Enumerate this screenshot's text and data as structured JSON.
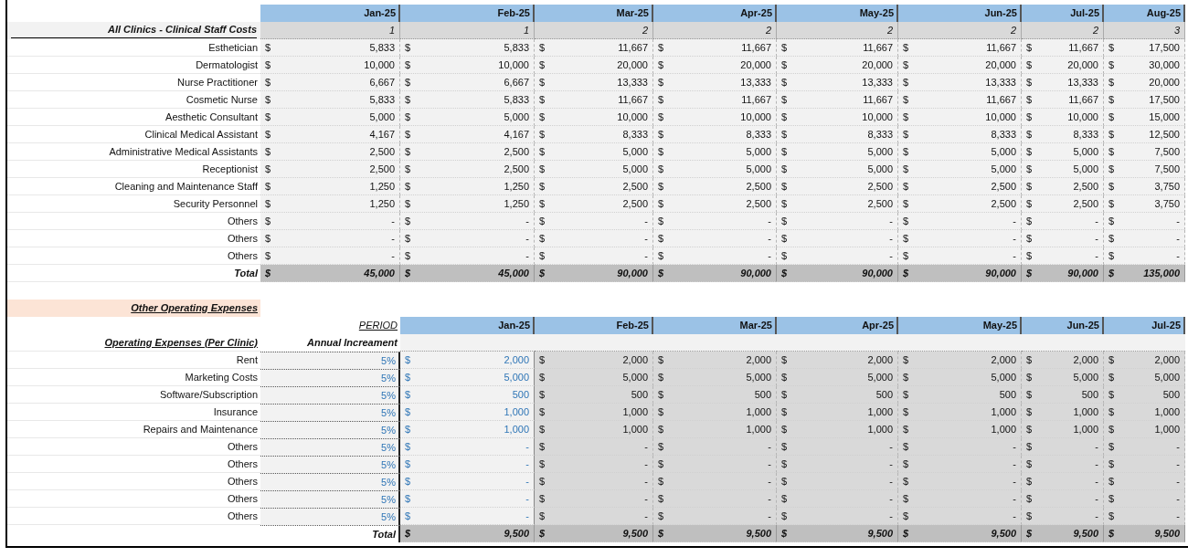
{
  "staff": {
    "title": "All Clinics - Clinical Staff Costs",
    "months": [
      "Jan-25",
      "Feb-25",
      "Mar-25",
      "Apr-25",
      "May-25",
      "Jun-25",
      "Jul-25",
      "Aug-25"
    ],
    "headcount": [
      "1",
      "1",
      "2",
      "2",
      "2",
      "2",
      "2",
      "3"
    ],
    "rows": [
      {
        "label": "Esthetician",
        "cells": [
          [
            "$",
            "5,833"
          ],
          [
            "$",
            "5,833"
          ],
          [
            "$",
            "11,667"
          ],
          [
            "$",
            "11,667"
          ],
          [
            "$",
            "11,667"
          ],
          [
            "$",
            "11,667"
          ],
          [
            "$",
            "11,667"
          ],
          [
            "$",
            "17,500"
          ]
        ]
      },
      {
        "label": "Dermatologist",
        "cells": [
          [
            "$",
            "10,000"
          ],
          [
            "$",
            "10,000"
          ],
          [
            "$",
            "20,000"
          ],
          [
            "$",
            "20,000"
          ],
          [
            "$",
            "20,000"
          ],
          [
            "$",
            "20,000"
          ],
          [
            "$",
            "20,000"
          ],
          [
            "$",
            "30,000"
          ]
        ]
      },
      {
        "label": "Nurse Practitioner",
        "cells": [
          [
            "$",
            "6,667"
          ],
          [
            "$",
            "6,667"
          ],
          [
            "$",
            "13,333"
          ],
          [
            "$",
            "13,333"
          ],
          [
            "$",
            "13,333"
          ],
          [
            "$",
            "13,333"
          ],
          [
            "$",
            "13,333"
          ],
          [
            "$",
            "20,000"
          ]
        ]
      },
      {
        "label": "Cosmetic Nurse",
        "cells": [
          [
            "$",
            "5,833"
          ],
          [
            "$",
            "5,833"
          ],
          [
            "$",
            "11,667"
          ],
          [
            "$",
            "11,667"
          ],
          [
            "$",
            "11,667"
          ],
          [
            "$",
            "11,667"
          ],
          [
            "$",
            "11,667"
          ],
          [
            "$",
            "17,500"
          ]
        ]
      },
      {
        "label": "Aesthetic Consultant",
        "cells": [
          [
            "$",
            "5,000"
          ],
          [
            "$",
            "5,000"
          ],
          [
            "$",
            "10,000"
          ],
          [
            "$",
            "10,000"
          ],
          [
            "$",
            "10,000"
          ],
          [
            "$",
            "10,000"
          ],
          [
            "$",
            "10,000"
          ],
          [
            "$",
            "15,000"
          ]
        ]
      },
      {
        "label": "Clinical Medical Assistant",
        "cells": [
          [
            "$",
            "4,167"
          ],
          [
            "$",
            "4,167"
          ],
          [
            "$",
            "8,333"
          ],
          [
            "$",
            "8,333"
          ],
          [
            "$",
            "8,333"
          ],
          [
            "$",
            "8,333"
          ],
          [
            "$",
            "8,333"
          ],
          [
            "$",
            "12,500"
          ]
        ]
      },
      {
        "label": "Administrative Medical Assistants",
        "cells": [
          [
            "$",
            "2,500"
          ],
          [
            "$",
            "2,500"
          ],
          [
            "$",
            "5,000"
          ],
          [
            "$",
            "5,000"
          ],
          [
            "$",
            "5,000"
          ],
          [
            "$",
            "5,000"
          ],
          [
            "$",
            "5,000"
          ],
          [
            "$",
            "7,500"
          ]
        ]
      },
      {
        "label": "Receptionist",
        "cells": [
          [
            "$",
            "2,500"
          ],
          [
            "$",
            "2,500"
          ],
          [
            "$",
            "5,000"
          ],
          [
            "$",
            "5,000"
          ],
          [
            "$",
            "5,000"
          ],
          [
            "$",
            "5,000"
          ],
          [
            "$",
            "5,000"
          ],
          [
            "$",
            "7,500"
          ]
        ]
      },
      {
        "label": "Cleaning and Maintenance Staff",
        "cells": [
          [
            "$",
            "1,250"
          ],
          [
            "$",
            "1,250"
          ],
          [
            "$",
            "2,500"
          ],
          [
            "$",
            "2,500"
          ],
          [
            "$",
            "2,500"
          ],
          [
            "$",
            "2,500"
          ],
          [
            "$",
            "2,500"
          ],
          [
            "$",
            "3,750"
          ]
        ]
      },
      {
        "label": "Security Personnel",
        "cells": [
          [
            "$",
            "1,250"
          ],
          [
            "$",
            "1,250"
          ],
          [
            "$",
            "2,500"
          ],
          [
            "$",
            "2,500"
          ],
          [
            "$",
            "2,500"
          ],
          [
            "$",
            "2,500"
          ],
          [
            "$",
            "2,500"
          ],
          [
            "$",
            "3,750"
          ]
        ]
      },
      {
        "label": "Others",
        "cells": [
          [
            "$",
            "-"
          ],
          [
            "$",
            "-"
          ],
          [
            "$",
            "-"
          ],
          [
            "$",
            "-"
          ],
          [
            "$",
            "-"
          ],
          [
            "$",
            "-"
          ],
          [
            "$",
            "-"
          ],
          [
            "$",
            "-"
          ]
        ]
      },
      {
        "label": "Others",
        "cells": [
          [
            "$",
            "-"
          ],
          [
            "$",
            "-"
          ],
          [
            "$",
            "-"
          ],
          [
            "$",
            "-"
          ],
          [
            "$",
            "-"
          ],
          [
            "$",
            "-"
          ],
          [
            "$",
            "-"
          ],
          [
            "$",
            "-"
          ]
        ]
      },
      {
        "label": "Others",
        "cells": [
          [
            "$",
            "-"
          ],
          [
            "$",
            "-"
          ],
          [
            "$",
            "-"
          ],
          [
            "$",
            "-"
          ],
          [
            "$",
            "-"
          ],
          [
            "$",
            "-"
          ],
          [
            "$",
            "-"
          ],
          [
            "$",
            "-"
          ]
        ]
      }
    ],
    "total": {
      "label": "Total",
      "cells": [
        [
          "$",
          "45,000"
        ],
        [
          "$",
          "45,000"
        ],
        [
          "$",
          "90,000"
        ],
        [
          "$",
          "90,000"
        ],
        [
          "$",
          "90,000"
        ],
        [
          "$",
          "90,000"
        ],
        [
          "$",
          "90,000"
        ],
        [
          "$",
          "135,000"
        ]
      ]
    }
  },
  "opex": {
    "title": "Other Operating Expenses",
    "period_label": "PERIOD",
    "subtitle": "Operating Expenses (Per Clinic)",
    "increment_label": "Annual Increament",
    "columns": [
      {
        "label": "Jan-25",
        "input": true
      },
      {
        "label": "Feb-25",
        "input": false
      },
      {
        "label": "Mar-25",
        "input": false
      },
      {
        "label": "Apr-25",
        "input": false
      },
      {
        "label": "May-25",
        "input": false
      },
      {
        "label": "Jun-25",
        "input": false
      },
      {
        "label": "Jul-25",
        "input": false
      }
    ],
    "rows": [
      {
        "label": "Rent",
        "increment": "5%",
        "cells": [
          [
            "$",
            "2,000"
          ],
          [
            "$",
            "2,000"
          ],
          [
            "$",
            "2,000"
          ],
          [
            "$",
            "2,000"
          ],
          [
            "$",
            "2,000"
          ],
          [
            "$",
            "2,000"
          ],
          [
            "$",
            "2,000"
          ]
        ]
      },
      {
        "label": "Marketing Costs",
        "increment": "5%",
        "cells": [
          [
            "$",
            "5,000"
          ],
          [
            "$",
            "5,000"
          ],
          [
            "$",
            "5,000"
          ],
          [
            "$",
            "5,000"
          ],
          [
            "$",
            "5,000"
          ],
          [
            "$",
            "5,000"
          ],
          [
            "$",
            "5,000"
          ]
        ]
      },
      {
        "label": "Software/Subscription",
        "increment": "5%",
        "cells": [
          [
            "$",
            "500"
          ],
          [
            "$",
            "500"
          ],
          [
            "$",
            "500"
          ],
          [
            "$",
            "500"
          ],
          [
            "$",
            "500"
          ],
          [
            "$",
            "500"
          ],
          [
            "$",
            "500"
          ]
        ]
      },
      {
        "label": "Insurance",
        "increment": "5%",
        "cells": [
          [
            "$",
            "1,000"
          ],
          [
            "$",
            "1,000"
          ],
          [
            "$",
            "1,000"
          ],
          [
            "$",
            "1,000"
          ],
          [
            "$",
            "1,000"
          ],
          [
            "$",
            "1,000"
          ],
          [
            "$",
            "1,000"
          ]
        ]
      },
      {
        "label": "Repairs and Maintenance",
        "increment": "5%",
        "cells": [
          [
            "$",
            "1,000"
          ],
          [
            "$",
            "1,000"
          ],
          [
            "$",
            "1,000"
          ],
          [
            "$",
            "1,000"
          ],
          [
            "$",
            "1,000"
          ],
          [
            "$",
            "1,000"
          ],
          [
            "$",
            "1,000"
          ]
        ]
      },
      {
        "label": "Others",
        "increment": "5%",
        "cells": [
          [
            "$",
            "-"
          ],
          [
            "$",
            "-"
          ],
          [
            "$",
            "-"
          ],
          [
            "$",
            "-"
          ],
          [
            "$",
            "-"
          ],
          [
            "$",
            "-"
          ],
          [
            "$",
            "-"
          ]
        ]
      },
      {
        "label": "Others",
        "increment": "5%",
        "cells": [
          [
            "$",
            "-"
          ],
          [
            "$",
            "-"
          ],
          [
            "$",
            "-"
          ],
          [
            "$",
            "-"
          ],
          [
            "$",
            "-"
          ],
          [
            "$",
            "-"
          ],
          [
            "$",
            "-"
          ]
        ]
      },
      {
        "label": "Others",
        "increment": "5%",
        "cells": [
          [
            "$",
            "-"
          ],
          [
            "$",
            "-"
          ],
          [
            "$",
            "-"
          ],
          [
            "$",
            "-"
          ],
          [
            "$",
            "-"
          ],
          [
            "$",
            "-"
          ],
          [
            "$",
            "-"
          ]
        ]
      },
      {
        "label": "Others",
        "increment": "5%",
        "cells": [
          [
            "$",
            "-"
          ],
          [
            "$",
            "-"
          ],
          [
            "$",
            "-"
          ],
          [
            "$",
            "-"
          ],
          [
            "$",
            "-"
          ],
          [
            "$",
            "-"
          ],
          [
            "$",
            "-"
          ]
        ]
      },
      {
        "label": "Others",
        "increment": "5%",
        "cells": [
          [
            "$",
            "-"
          ],
          [
            "$",
            "-"
          ],
          [
            "$",
            "-"
          ],
          [
            "$",
            "-"
          ],
          [
            "$",
            "-"
          ],
          [
            "$",
            "-"
          ],
          [
            "$",
            "-"
          ]
        ]
      }
    ],
    "total": {
      "label": "Total",
      "cells": [
        [
          "$",
          "9,500"
        ],
        [
          "$",
          "9,500"
        ],
        [
          "$",
          "9,500"
        ],
        [
          "$",
          "9,500"
        ],
        [
          "$",
          "9,500"
        ],
        [
          "$",
          "9,500"
        ],
        [
          "$",
          "9,500"
        ]
      ]
    }
  }
}
